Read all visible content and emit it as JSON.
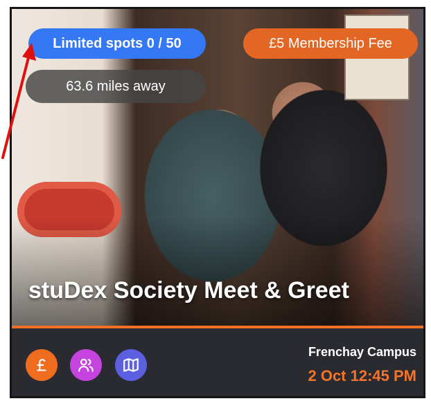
{
  "card": {
    "spots_badge": "Limited spots 0 / 50",
    "fee_badge": "£5 Membership Fee",
    "distance": "63.6 miles away",
    "title": "stuDex Society Meet & Greet",
    "location": "Frenchay Campus",
    "datetime": "2 Oct 12:45 PM"
  },
  "icons": {
    "fee": "pound-icon",
    "members": "people-icon",
    "map": "map-icon"
  },
  "colors": {
    "spots_badge": "#3478f6",
    "fee_badge": "#e46624",
    "accent": "#f07028",
    "footer_bg": "#2a2a31",
    "people_button": "#c543df",
    "map_button": "#5b5fe0",
    "annotation_arrow": "#e01010"
  }
}
